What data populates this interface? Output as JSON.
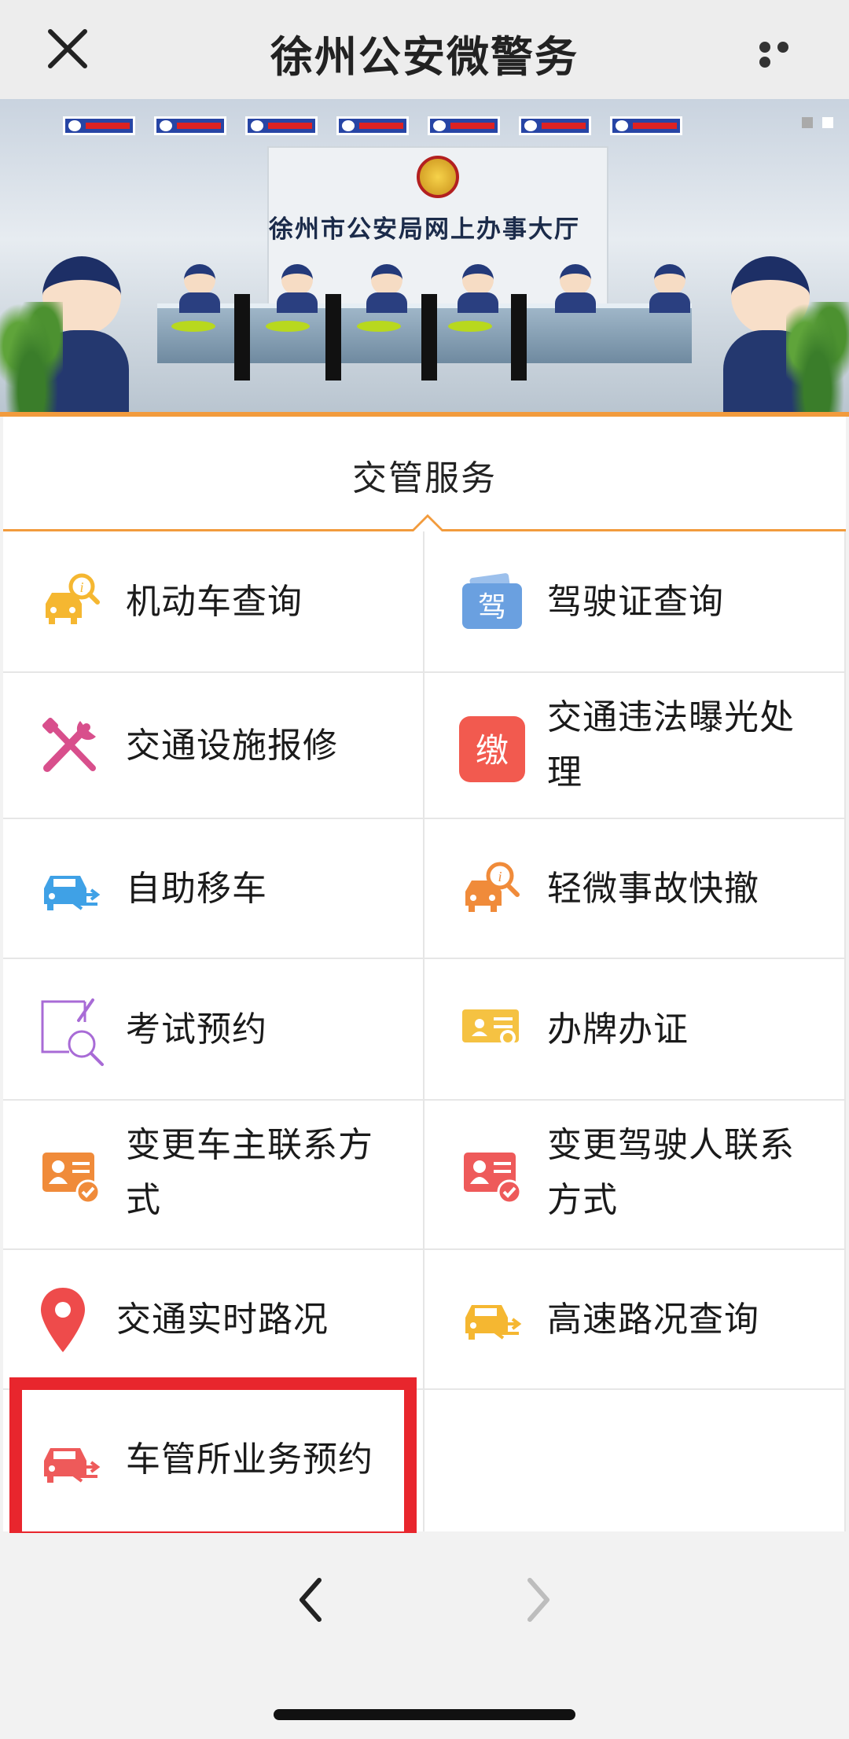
{
  "nav": {
    "title": "徐州公安微警务",
    "close_icon": "close-icon",
    "more_icon": "more-icon"
  },
  "banner": {
    "hall_name": "徐州市公安局网上办事大厅",
    "slide_count": 2,
    "active_slide": 2
  },
  "section": {
    "tab_label": "交管服务",
    "accent_color": "#f29b3d"
  },
  "services": [
    {
      "label": "机动车查询",
      "icon": "car-search-icon",
      "color": "#f5b731"
    },
    {
      "label": "驾驶证查询",
      "icon": "driver-license-icon",
      "icon_text": "驾",
      "color": "#6aa0e0"
    },
    {
      "label": "交通设施报修",
      "icon": "repair-tools-icon",
      "color": "#d84f8c"
    },
    {
      "label": "交通违法曝光处理",
      "icon": "fine-payment-icon",
      "icon_text": "缴",
      "color": "#f25a4f"
    },
    {
      "label": "自助移车",
      "icon": "car-move-icon",
      "color": "#3fa1e6"
    },
    {
      "label": "轻微事故快撤",
      "icon": "accident-icon",
      "color": "#f08b3a"
    },
    {
      "label": "考试预约",
      "icon": "exam-booking-icon",
      "color": "#a86bd6"
    },
    {
      "label": "办牌办证",
      "icon": "plate-certificate-icon",
      "color": "#f5c242"
    },
    {
      "label": "变更车主联系方式",
      "icon": "owner-contact-icon",
      "color": "#f08b3a"
    },
    {
      "label": "变更驾驶人联系方式",
      "icon": "driver-contact-icon",
      "color": "#ee5a5a"
    },
    {
      "label": "交通实时路况",
      "icon": "location-pin-icon",
      "color": "#ee4b4b"
    },
    {
      "label": "高速路况查询",
      "icon": "highway-car-icon",
      "color": "#f5b731"
    },
    {
      "label": "车管所业务预约",
      "icon": "dmv-booking-icon",
      "color": "#ee5a5a"
    }
  ],
  "highlight_color": "#e8262d",
  "bottom_nav": {
    "back_icon": "chevron-left-icon",
    "forward_icon": "chevron-right-icon"
  }
}
